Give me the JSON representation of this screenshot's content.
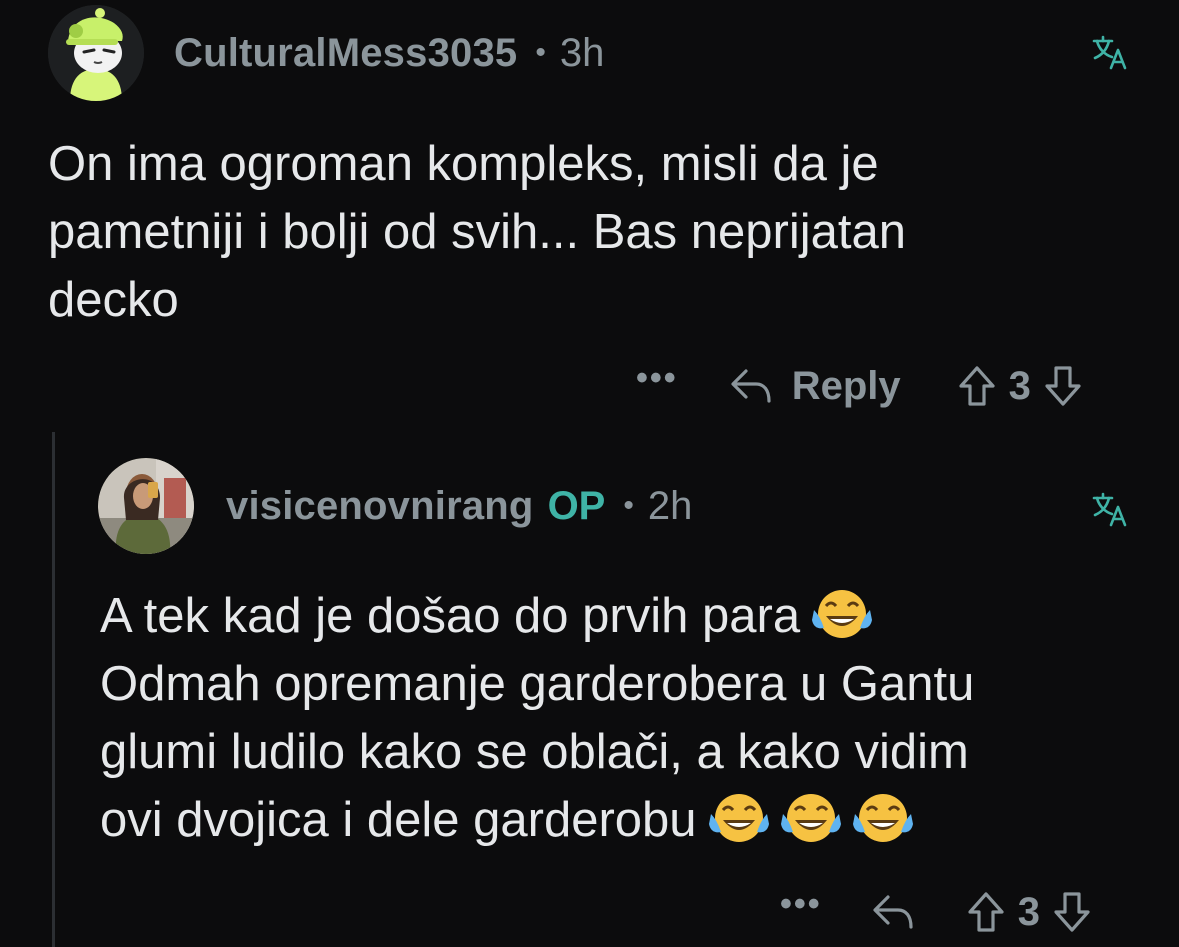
{
  "comments": [
    {
      "author": "CulturalMess3035",
      "separator": "•",
      "time": "3h",
      "body": "On ima ogroman kompleks, misli da je\npametniji i bolji od svih... Bas neprijatan\ndecko",
      "more_label": "•••",
      "reply_label": "Reply",
      "score": "3",
      "avatar_icon": "snoo-green-hat-avatar-icon"
    },
    {
      "author": "visicenovnirang",
      "op_badge": "OP",
      "separator": "•",
      "time": "2h",
      "body_line1": "A tek kad je došao do prvih para",
      "body_rest": "Odmah opremanje garderobera u Gantu\nglumi ludilo kako se oblači, a kako vidim\novi dvojica i dele garderobu",
      "more_label": "•••",
      "score": "3",
      "avatar_icon": "user-photo-avatar-icon",
      "emoji": "face-with-tears-of-joy-emoji"
    }
  ],
  "colors": {
    "background": "#0c0c0d",
    "meta_text": "#8b959b",
    "body_text": "#e6e8ea",
    "op_badge": "#3fb3a6",
    "translate_icon": "#3fb3a6",
    "thread_line": "#2c2f33"
  },
  "icons": {
    "translate": "translate-icon",
    "reply": "reply-arrow-icon",
    "upvote": "upvote-arrow-icon",
    "downvote": "downvote-arrow-icon"
  }
}
